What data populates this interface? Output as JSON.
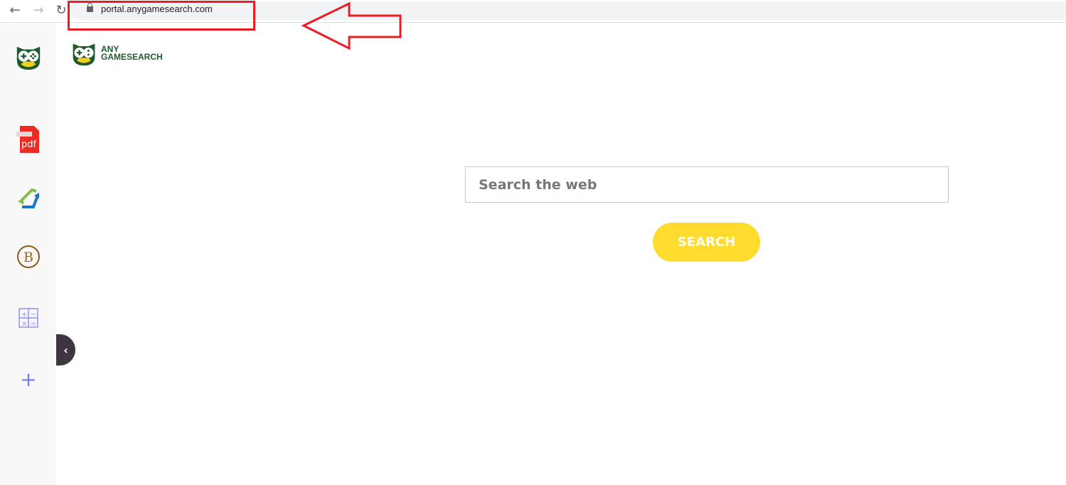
{
  "browser": {
    "url": "portal.anygamesearch.com",
    "icons": [
      "back-icon",
      "forward-icon",
      "reload-icon",
      "lock-icon"
    ]
  },
  "annotation": {
    "color": "#ec1c24"
  },
  "logo": {
    "line1": "ANY",
    "line2": "GAMESEARCH"
  },
  "sidebar": {
    "items": [
      "anygamesearch-owl",
      "pdf",
      "convert-arrows",
      "bitcoin",
      "calculator",
      "add"
    ],
    "toggle": "‹"
  },
  "search": {
    "placeholder": "Search the web",
    "value": "",
    "button": "SEARCH",
    "button_color": "#fedb2d"
  }
}
